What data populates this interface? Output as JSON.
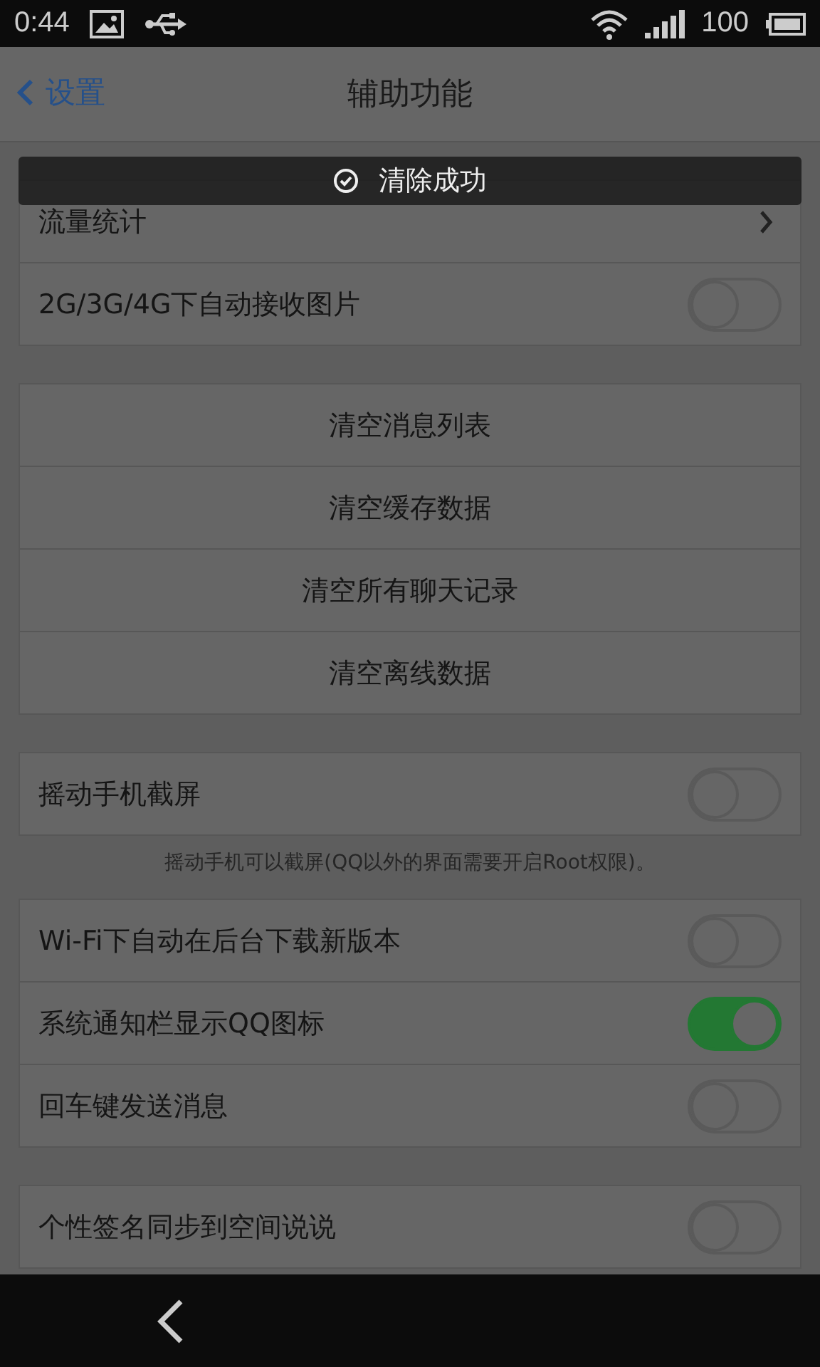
{
  "status_bar": {
    "time": "0:44",
    "battery": "100"
  },
  "nav": {
    "back": "设置",
    "title": "辅助功能"
  },
  "toast": {
    "text": "清除成功"
  },
  "groups": [
    {
      "rows": [
        {
          "kind": "link",
          "label": "流量统计"
        },
        {
          "kind": "toggle",
          "label": "2G/3G/4G下自动接收图片",
          "on": false
        }
      ]
    },
    {
      "rows": [
        {
          "kind": "action",
          "label": "清空消息列表"
        },
        {
          "kind": "action",
          "label": "清空缓存数据"
        },
        {
          "kind": "action",
          "label": "清空所有聊天记录"
        },
        {
          "kind": "action",
          "label": "清空离线数据"
        }
      ]
    },
    {
      "rows": [
        {
          "kind": "toggle",
          "label": "摇动手机截屏",
          "on": false
        }
      ],
      "footnote": "摇动手机可以截屏(QQ以外的界面需要开启Root权限)。"
    },
    {
      "rows": [
        {
          "kind": "toggle",
          "label": "Wi-Fi下自动在后台下载新版本",
          "on": false
        },
        {
          "kind": "toggle",
          "label": "系统通知栏显示QQ图标",
          "on": true
        },
        {
          "kind": "toggle",
          "label": "回车键发送消息",
          "on": false
        }
      ]
    },
    {
      "rows": [
        {
          "kind": "toggle",
          "label": "个性签名同步到空间说说",
          "on": false
        }
      ]
    }
  ]
}
